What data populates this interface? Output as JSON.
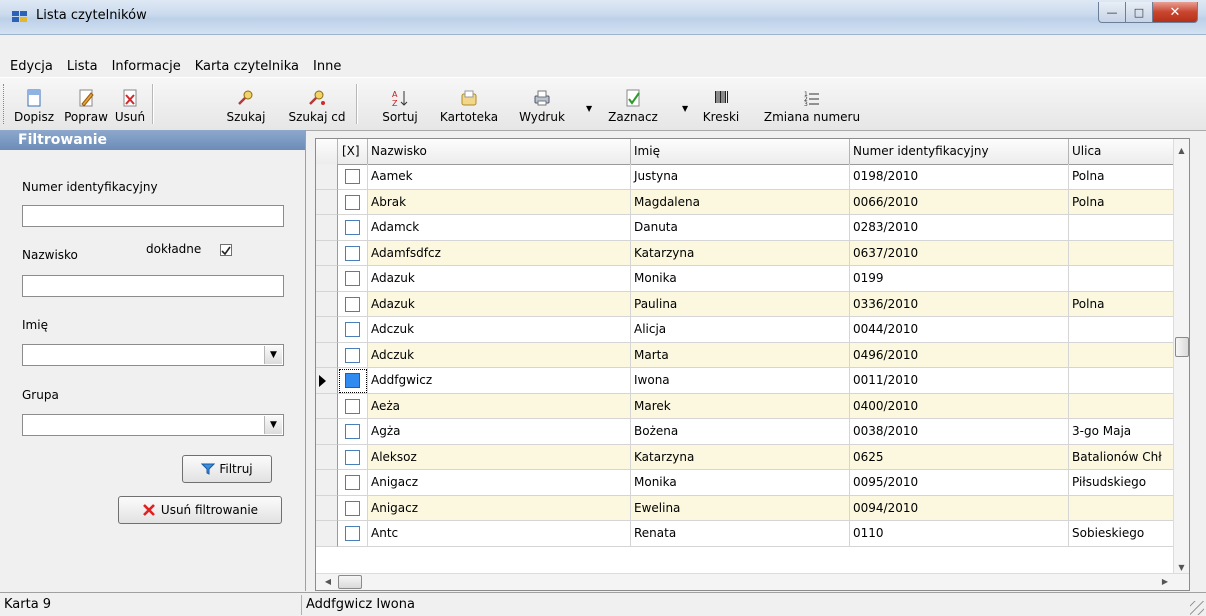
{
  "window": {
    "title": "Lista czytelników"
  },
  "menu": [
    {
      "label": "Edycja"
    },
    {
      "label": "Lista"
    },
    {
      "label": "Informacje"
    },
    {
      "label": "Karta czytelnika"
    },
    {
      "label": "Inne"
    }
  ],
  "toolbar": {
    "dopisz": "Dopisz",
    "popraw": "Popraw",
    "usun": "Usuń",
    "szukaj": "Szukaj",
    "szukaj_cd": "Szukaj cd",
    "sortuj": "Sortuj",
    "kartoteka": "Kartoteka",
    "wydruk": "Wydruk",
    "zaznacz": "Zaznacz",
    "kreski": "Kreski",
    "zmiana_numeru": "Zmiana numeru"
  },
  "filter": {
    "header": "Filtrowanie",
    "numer_label": "Numer identyfikacyjny",
    "numer_value": "",
    "nazwisko_label": "Nazwisko",
    "dokladne_label": "dokładne",
    "dokladne_checked": "true",
    "nazwisko_value": "",
    "imie_label": "Imię",
    "imie_value": "",
    "grupa_label": "Grupa",
    "grupa_value": "",
    "filtruj_button": "Filtruj",
    "usun_button": "Usuń filtrowanie"
  },
  "grid": {
    "columns": [
      "[X]",
      "Nazwisko",
      "Imię",
      "Numer identyfikacyjny",
      "Ulica"
    ],
    "rows": [
      {
        "nazwisko": "Aamek",
        "imie": "Justyna",
        "numer": "0198/2010",
        "ulica": "Polna"
      },
      {
        "nazwisko": "Abrak",
        "imie": "Magdalena",
        "numer": "0066/2010",
        "ulica": "Polna"
      },
      {
        "nazwisko": "Adamck",
        "imie": "Danuta",
        "numer": "0283/2010",
        "ulica": ""
      },
      {
        "nazwisko": "Adamfsdfcz",
        "imie": "Katarzyna",
        "numer": "0637/2010",
        "ulica": ""
      },
      {
        "nazwisko": "Adazuk",
        "imie": "Monika",
        "numer": "0199",
        "ulica": ""
      },
      {
        "nazwisko": "Adazuk",
        "imie": "Paulina",
        "numer": "0336/2010",
        "ulica": "Polna"
      },
      {
        "nazwisko": "Adczuk",
        "imie": "Alicja",
        "numer": "0044/2010",
        "ulica": ""
      },
      {
        "nazwisko": "Adczuk",
        "imie": "Marta",
        "numer": "0496/2010",
        "ulica": ""
      },
      {
        "nazwisko": "Addfgwicz",
        "imie": "Iwona",
        "numer": "0011/2010",
        "ulica": ""
      },
      {
        "nazwisko": "Aeża",
        "imie": "Marek",
        "numer": "0400/2010",
        "ulica": ""
      },
      {
        "nazwisko": "Agża",
        "imie": "Bożena",
        "numer": "0038/2010",
        "ulica": "3-go Maja"
      },
      {
        "nazwisko": "Aleksoz",
        "imie": "Katarzyna",
        "numer": "0625",
        "ulica": "Batalionów Chł"
      },
      {
        "nazwisko": "Anigacz",
        "imie": "Monika",
        "numer": "0095/2010",
        "ulica": "Piłsudskiego"
      },
      {
        "nazwisko": "Anigacz",
        "imie": "Ewelina",
        "numer": "0094/2010",
        "ulica": ""
      },
      {
        "nazwisko": "Antc",
        "imie": "Renata",
        "numer": "0110",
        "ulica": "Sobieskiego"
      }
    ]
  },
  "status": {
    "left": "Karta 9",
    "right": "Addfgwicz Iwona"
  }
}
